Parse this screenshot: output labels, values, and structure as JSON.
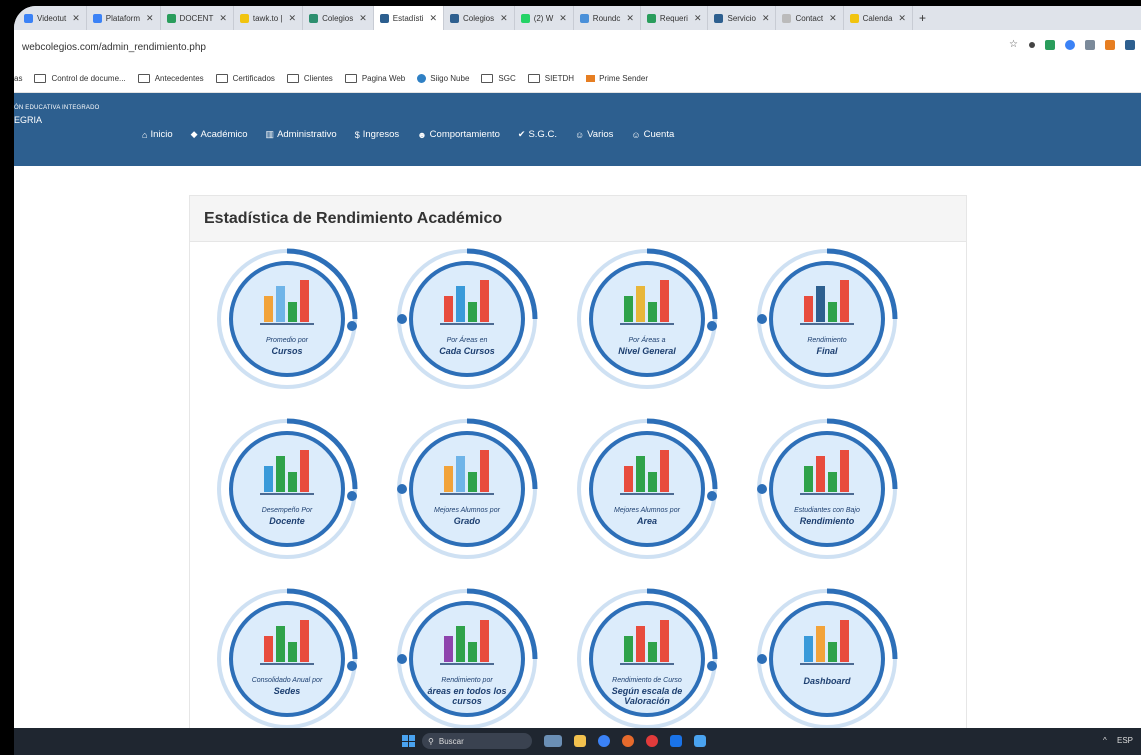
{
  "browser": {
    "tabs": [
      {
        "label": "Videotut",
        "color": "#3b82f6"
      },
      {
        "label": "Plataform",
        "color": "#3b82f6"
      },
      {
        "label": "DOCENT",
        "color": "#2a9d5c"
      },
      {
        "label": "tawk.to |",
        "color": "#f1c40f"
      },
      {
        "label": "Colegios",
        "color": "#2d8f6f"
      },
      {
        "label": "Estadísti",
        "color": "#2d5f8f",
        "active": true
      },
      {
        "label": "Colegios",
        "color": "#2d5f8f"
      },
      {
        "label": "(2) W",
        "color": "#25d366"
      },
      {
        "label": "Roundc",
        "color": "#4a90d9"
      },
      {
        "label": "Requeri",
        "color": "#2a9d5c"
      },
      {
        "label": "Servicio",
        "color": "#2d5f8f"
      },
      {
        "label": "Contact",
        "color": "#bbbbbb"
      },
      {
        "label": "Calenda",
        "color": "#f1c40f"
      }
    ],
    "new_tab": "+",
    "url": "webcolegios.com/admin_rendimiento.php"
  },
  "bookmarks": [
    {
      "label": "as",
      "icon": "none"
    },
    {
      "label": "Control de docume...",
      "icon": "folder-icon"
    },
    {
      "label": "Antecedentes",
      "icon": "folder-icon"
    },
    {
      "label": "Certificados",
      "icon": "folder-icon"
    },
    {
      "label": "Clientes",
      "icon": "folder-icon"
    },
    {
      "label": "Pagina Web",
      "icon": "folder-icon"
    },
    {
      "label": "Siigo Nube",
      "icon": "cloud-icon"
    },
    {
      "label": "SGC",
      "icon": "folder-icon"
    },
    {
      "label": "SIETDH",
      "icon": "folder-icon"
    },
    {
      "label": "Prime Sender",
      "icon": "sender-icon"
    }
  ],
  "header": {
    "institution_line1": "ÓN EDUCATIVA INTEGRADO",
    "institution_line2": "EGRIA",
    "menu": [
      {
        "label": "Inicio",
        "icon": "home-icon",
        "glyph": "⌂"
      },
      {
        "label": "Académico",
        "icon": "graduation-cap-icon",
        "glyph": "◆"
      },
      {
        "label": "Administrativo",
        "icon": "bank-icon",
        "glyph": "▥"
      },
      {
        "label": "Ingresos",
        "icon": "money-icon",
        "glyph": "$"
      },
      {
        "label": "Comportamiento",
        "icon": "users-icon",
        "glyph": "☻"
      },
      {
        "label": "S.G.C.",
        "icon": "check-circle-icon",
        "glyph": "✔"
      },
      {
        "label": "Varios",
        "icon": "group-icon",
        "glyph": "☺"
      },
      {
        "label": "Cuenta",
        "icon": "user-gear-icon",
        "glyph": "☺"
      }
    ]
  },
  "panel": {
    "title": "Estadística de Rendimiento Académico",
    "cards": [
      {
        "id": "promedio-cursos",
        "small": "Promedio por",
        "big": "Cursos"
      },
      {
        "id": "areas-cada-cursos",
        "small": "Por Áreas en",
        "big": "Cada Cursos"
      },
      {
        "id": "areas-nivel-general",
        "small": "Por Áreas a",
        "big": "Nivel General"
      },
      {
        "id": "rendimiento-final",
        "small": "Rendimiento",
        "big": "Final"
      },
      {
        "id": "desempeno-docente",
        "small": "Desempeño Por",
        "big": "Docente"
      },
      {
        "id": "mejores-alumnos-grado",
        "small": "Mejores Alumnos por",
        "big": "Grado"
      },
      {
        "id": "mejores-alumnos-area",
        "small": "Mejores Alumnos por",
        "big": "Area"
      },
      {
        "id": "estudiantes-bajo-rendimiento",
        "small": "Estudiantes con Bajo",
        "big": "Rendimiento"
      },
      {
        "id": "consolidado-anual-sedes",
        "small": "Consolidado Anual por",
        "big": "Sedes"
      },
      {
        "id": "rendimiento-areas-todos-cursos",
        "small": "Rendimiento por",
        "big": "áreas en todos los cursos"
      },
      {
        "id": "rendimiento-curso-escala",
        "small": "Rendimiento de Curso",
        "big": "Según escala de Valoración"
      },
      {
        "id": "dashboard",
        "small": "",
        "big": "Dashboard"
      }
    ]
  },
  "taskbar": {
    "search_label": "Buscar",
    "tray_lang": "ESP"
  }
}
